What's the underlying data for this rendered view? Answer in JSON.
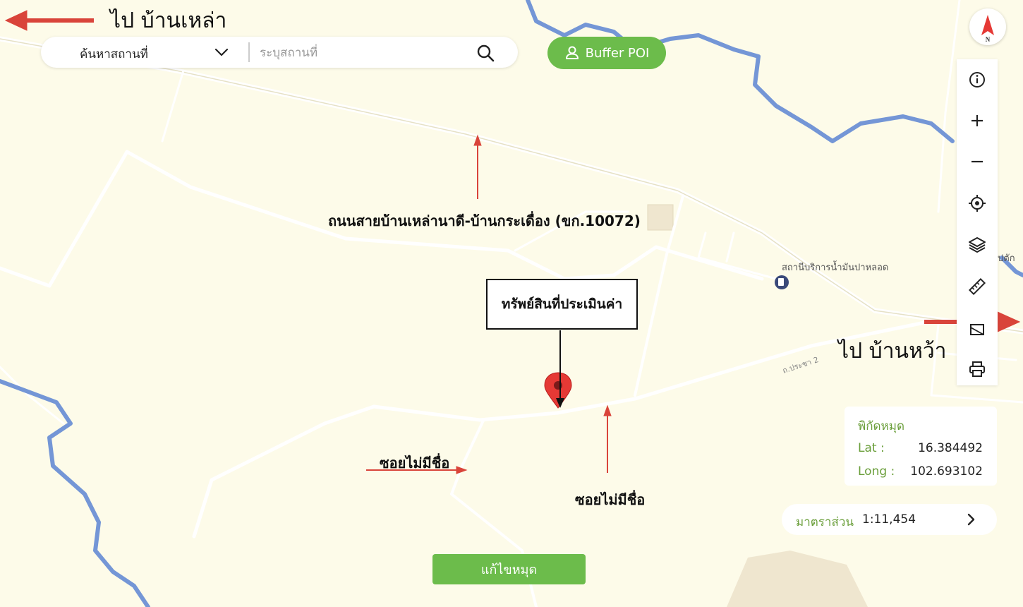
{
  "search": {
    "type_label": "ค้นหาสถานที่",
    "placeholder": "ระบุสถานที่"
  },
  "buffer_button": {
    "label": "Buffer POI"
  },
  "compass": {
    "north_label": "N"
  },
  "toolbar": {
    "tools": [
      "info-icon",
      "zoom-in-icon",
      "zoom-out-icon",
      "locate-icon",
      "layers-icon",
      "ruler-icon",
      "print-icon"
    ]
  },
  "coordinates": {
    "title": "พิกัดหมุด",
    "lat_label": "Lat :",
    "lat_value": "16.384492",
    "long_label": "Long :",
    "long_value": "102.693102"
  },
  "scale": {
    "label": "มาตราส่วน",
    "value": "1:11,454"
  },
  "edit_button": {
    "label": "แก้ไขหมุด"
  },
  "map_labels": {
    "poi_gas_station": "สถานีบริการน้ำมันปาหลอด",
    "poi_partial": "ปตัก",
    "street_small": "ถ.ประชา 2"
  },
  "annotations": {
    "to_left": "ไป  บ้านเหล่า",
    "to_right": "ไป  บ้านหว้า",
    "main_road": "ถนนสายบ้านเหล่านาดี-บ้านกระเดื่อง (ขก.10072)",
    "property": "ทรัพย์สินที่ประเมินค่า",
    "soi_left": "ซอยไม่มีชื่อ",
    "soi_bottom": "ซอยไม่มีชื่อ"
  },
  "colors": {
    "map_bg": "#fdfbe9",
    "road": "#ffffff",
    "river": "#7496d6",
    "accent_green": "#6cbc4b",
    "marker_red": "#e53935",
    "annotation_arrow": "#d9443a"
  }
}
